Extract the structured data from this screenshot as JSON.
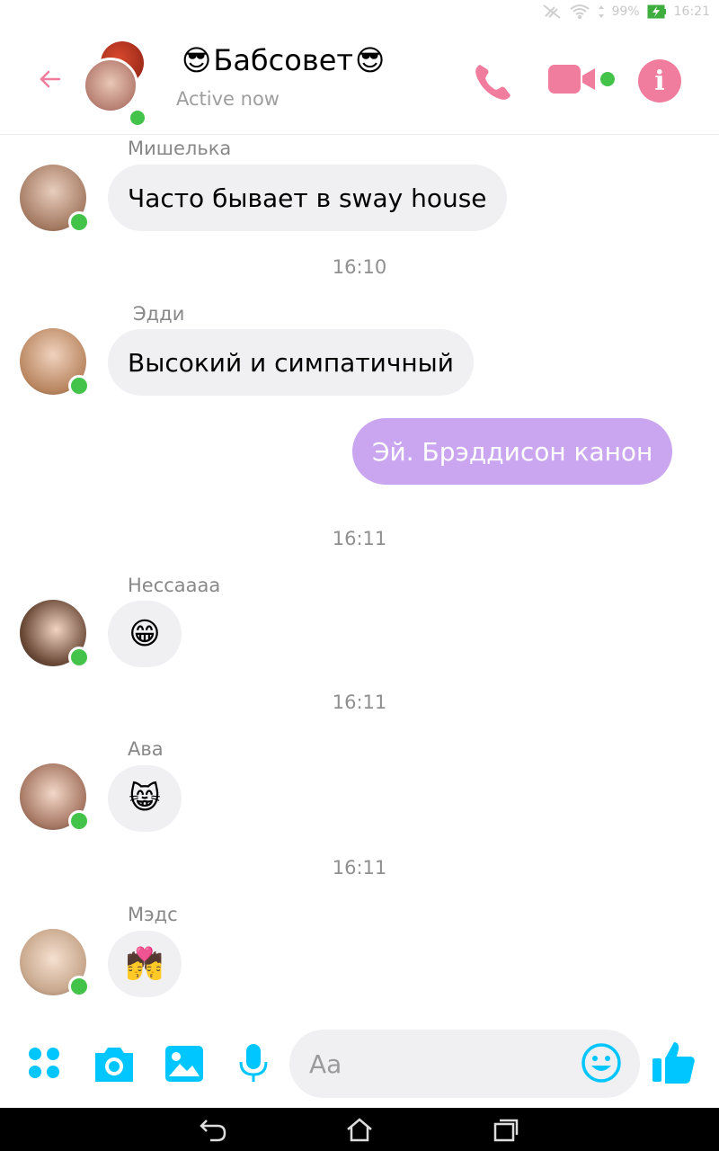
{
  "status_bar": {
    "battery": "99%",
    "time": "16:21"
  },
  "header": {
    "title": "Бабсовет",
    "title_emoji_left": "😎",
    "title_emoji_right": "😎",
    "status": "Active now"
  },
  "messages": [
    {
      "sender": "Мишелька",
      "text": "Часто бывает в sway house"
    },
    {
      "timestamp": "16:10"
    },
    {
      "sender": "Эдди",
      "text": "Высокий и симпатичный"
    },
    {
      "outgoing": "Эй. Брэддисон канон"
    },
    {
      "timestamp": "16:11"
    },
    {
      "sender": "Нессаааа",
      "emoji": "😁"
    },
    {
      "timestamp": "16:11"
    },
    {
      "sender": "Ава",
      "emoji": "😸"
    },
    {
      "timestamp": "16:11"
    },
    {
      "sender": "Мэдс",
      "emoji": "💏"
    }
  ],
  "composer": {
    "placeholder": "Aa"
  },
  "colors": {
    "accent_pink": "#f07d9d",
    "outgoing_bubble": "#c9a6ef",
    "incoming_bubble": "#f0eff2",
    "composer_icons": "#00c6ff",
    "online": "#44c34a"
  },
  "icons": {
    "header": [
      "back-arrow-icon",
      "phone-icon",
      "video-camera-icon",
      "info-icon"
    ],
    "composer": [
      "more-apps-icon",
      "camera-icon",
      "gallery-icon",
      "microphone-icon",
      "emoji-icon",
      "thumbs-up-icon"
    ],
    "nav": [
      "back-icon",
      "home-icon",
      "recents-icon"
    ]
  }
}
